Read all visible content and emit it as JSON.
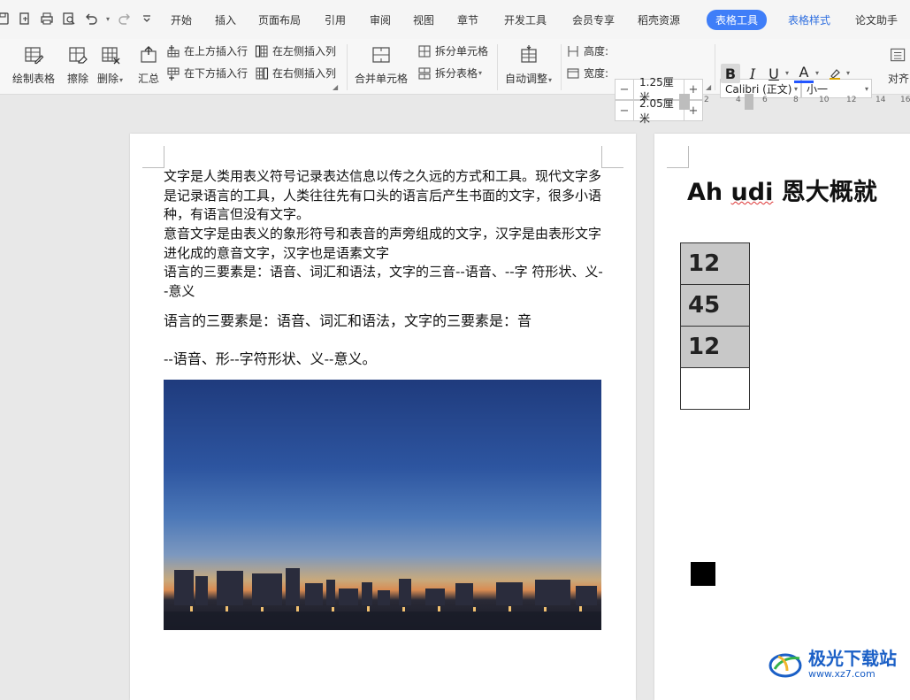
{
  "quick_access": [
    "save-icon",
    "export-pdf-icon",
    "print-icon",
    "print-preview-icon",
    "undo-icon",
    "redo-icon",
    "customize-icon"
  ],
  "menu_tabs": [
    {
      "id": "home",
      "label": "开始"
    },
    {
      "id": "insert",
      "label": "插入"
    },
    {
      "id": "layout",
      "label": "页面布局"
    },
    {
      "id": "references",
      "label": "引用"
    },
    {
      "id": "review",
      "label": "审阅"
    },
    {
      "id": "view",
      "label": "视图"
    },
    {
      "id": "section",
      "label": "章节"
    },
    {
      "id": "devtools",
      "label": "开发工具"
    },
    {
      "id": "member",
      "label": "会员专享"
    },
    {
      "id": "resources",
      "label": "稻壳资源"
    },
    {
      "id": "table_tools",
      "label": "表格工具"
    },
    {
      "id": "table_style",
      "label": "表格样式"
    },
    {
      "id": "thesis",
      "label": "论文助手"
    }
  ],
  "ribbon": {
    "draw_table": "绘制表格",
    "erase": "擦除",
    "delete": "删除",
    "summary": "汇总",
    "insert_row_above": "在上方插入行",
    "insert_row_below": "在下方插入行",
    "insert_col_left": "在左侧插入列",
    "insert_col_right": "在右侧插入列",
    "merge_cells": "合并单元格",
    "split_cells": "拆分单元格",
    "split_table": "拆分表格",
    "auto_fit": "自动调整",
    "height_label": "高度:",
    "height_value": "1.25厘米",
    "width_label": "宽度:",
    "width_value": "2.05厘米",
    "font_name": "Calibri (正文)",
    "font_size": "小一",
    "bold": "B",
    "italic": "I",
    "underline": "U",
    "font_color": "A",
    "align": "对齐"
  },
  "ruler_ticks": [
    "2",
    "4",
    "6",
    "8",
    "10",
    "12",
    "14",
    "16"
  ],
  "page1": {
    "paragraphs": [
      "文字是人类用表义符号记录表达信息以传之久远的方式和工具。现代文字多是记录语言的工具，人类往往先有口头的语言后产生书面的文字，很多小语种，有语言但没有文字。",
      "意音文字是由表义的象形符号和表音的声旁组成的文字，汉字是由表形文字进化成的意音文字，汉字也是语素文字",
      "语言的三要素是：语音、词汇和语法，文字的三音--语音、--字 符形状、义--意义"
    ],
    "serif_line1": "语言的三要素是：语音、词汇和语法，文字的三要素是：音",
    "serif_line2": "--语音、形--字符形状、义--意义。"
  },
  "page2": {
    "title_plain": "Ah ",
    "title_misspelled": "udi",
    "title_rest": " 恩大概就",
    "table_cells": [
      "12",
      "45",
      "12",
      ""
    ]
  },
  "watermark": {
    "title": "极光下载站",
    "url": "www.xz7.com"
  },
  "colors": {
    "accent": "#3f7ef8",
    "table_shade": "#c8c8c8",
    "watermark": "#1a5fc6"
  }
}
